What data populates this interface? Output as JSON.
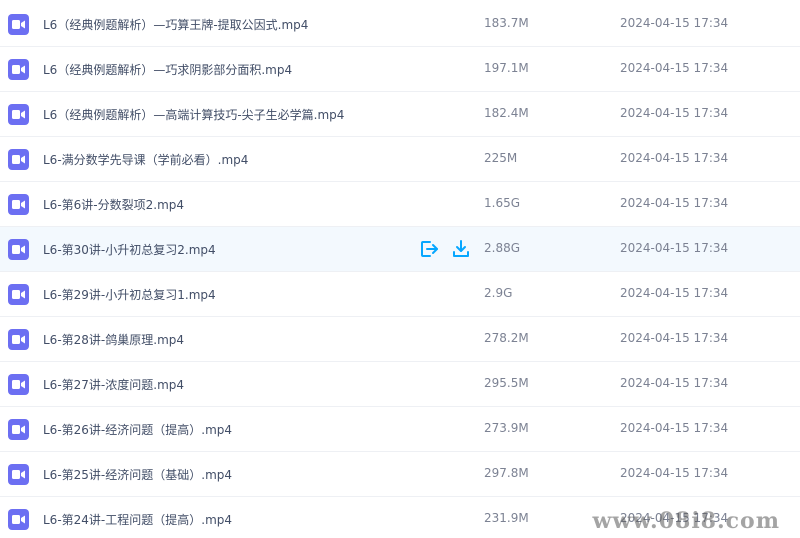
{
  "colors": {
    "file_icon": "#6c6ff2",
    "hover_row": "#f3f9fe",
    "action_icon": "#06a7ff"
  },
  "icons": {
    "file": "video-file-icon",
    "share": "share-icon",
    "download": "download-icon"
  },
  "files": [
    {
      "name": "L6（经典例题解析）—巧算王牌-提取公因式.mp4",
      "size": "183.7M",
      "date": "2024-04-15 17:34"
    },
    {
      "name": "L6（经典例题解析）—巧求阴影部分面积.mp4",
      "size": "197.1M",
      "date": "2024-04-15 17:34"
    },
    {
      "name": "L6（经典例题解析）—高端计算技巧-尖子生必学篇.mp4",
      "size": "182.4M",
      "date": "2024-04-15 17:34"
    },
    {
      "name": "L6-满分数学先导课（学前必看）.mp4",
      "size": "225M",
      "date": "2024-04-15 17:34"
    },
    {
      "name": "L6-第6讲-分数裂项2.mp4",
      "size": "1.65G",
      "date": "2024-04-15 17:34"
    },
    {
      "name": "L6-第30讲-小升初总复习2.mp4",
      "size": "2.88G",
      "date": "2024-04-15 17:34"
    },
    {
      "name": "L6-第29讲-小升初总复习1.mp4",
      "size": "2.9G",
      "date": "2024-04-15 17:34"
    },
    {
      "name": "L6-第28讲-鸽巢原理.mp4",
      "size": "278.2M",
      "date": "2024-04-15 17:34"
    },
    {
      "name": "L6-第27讲-浓度问题.mp4",
      "size": "295.5M",
      "date": "2024-04-15 17:34"
    },
    {
      "name": "L6-第26讲-经济问题（提高）.mp4",
      "size": "273.9M",
      "date": "2024-04-15 17:34"
    },
    {
      "name": "L6-第25讲-经济问题（基础）.mp4",
      "size": "297.8M",
      "date": "2024-04-15 17:34"
    },
    {
      "name": "L6-第24讲-工程问题（提高）.mp4",
      "size": "231.9M",
      "date": "2024-04-15 17:34"
    }
  ],
  "watermark": "www.08i8.com"
}
